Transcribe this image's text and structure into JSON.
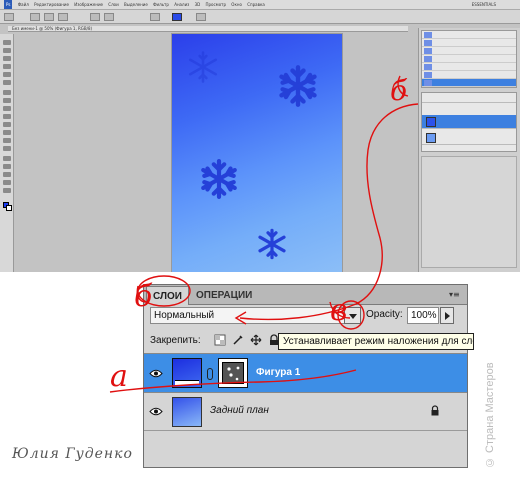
{
  "app": {
    "menu_items": [
      "Файл",
      "Редактирование",
      "Изображение",
      "Слои",
      "Выделение",
      "Фильтр",
      "Анализ",
      "3D",
      "Просмотр",
      "Окно",
      "Справка"
    ],
    "workspace_label": "ESSENTIALS",
    "doc_tab": "Без имени-1 @ 50% (Фигура 1, RGB/8)"
  },
  "layers_panel": {
    "tab_active": "СЛОИ",
    "tab_other": "ОПЕРАЦИИ",
    "menu_glyph": "▾≡",
    "blend_mode": "Нормальный",
    "opacity_label": "Opacity:",
    "opacity_value": "100%",
    "lock_label": "Закрепить:",
    "tooltip": "Устанавливает режим наложения для слоя",
    "layers": [
      {
        "name": "Фигура 1",
        "selected": true
      },
      {
        "name": "Задний план",
        "selected": false
      }
    ]
  },
  "annotations": {
    "a": "а",
    "b": "б",
    "v": "в"
  },
  "signature": "Юлия Гуденко",
  "watermark": "© Страна Мастеров",
  "colors": {
    "selection": "#3d8ee6",
    "canvas_dark": "#2b3fea",
    "canvas_light": "#8dbff7",
    "annotation": "#e01010",
    "snowflake": "#2540d8"
  }
}
